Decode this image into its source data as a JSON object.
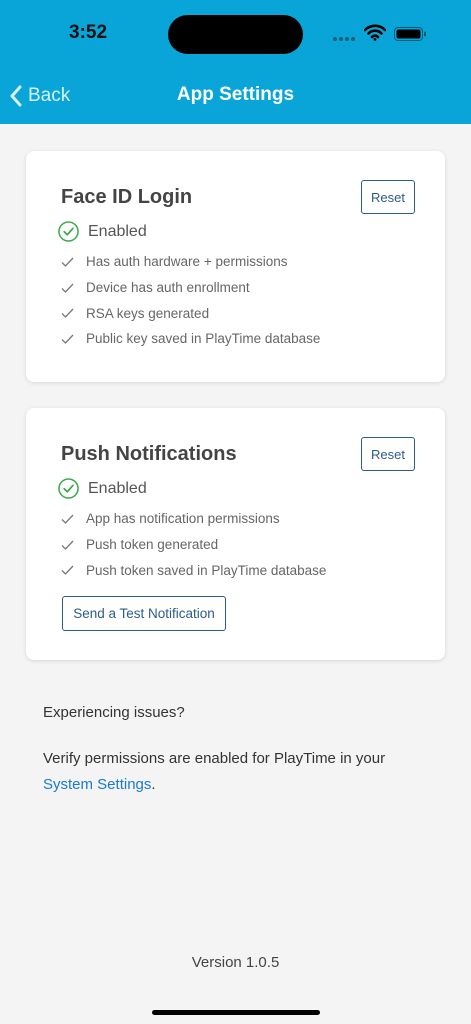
{
  "status_bar": {
    "time": "3:52"
  },
  "nav": {
    "back_label": "Back",
    "title": "App Settings"
  },
  "colors": {
    "header": "#0aa5d8",
    "accent": "#2d5c8a",
    "success": "#3aaa48",
    "link": "#1a7bd3"
  },
  "face_id": {
    "title": "Face ID Login",
    "reset_label": "Reset",
    "status": "Enabled",
    "checks": [
      "Has auth hardware + permissions",
      "Device has auth enrollment",
      "RSA keys generated",
      "Public key saved in PlayTime database"
    ]
  },
  "push": {
    "title": "Push Notifications",
    "reset_label": "Reset",
    "status": "Enabled",
    "checks": [
      "App has notification permissions",
      "Push token generated",
      "Push token saved in PlayTime database"
    ],
    "test_label": "Send a Test Notification"
  },
  "footer": {
    "issues": "Experiencing issues?",
    "verify_prefix": "Verify permissions are enabled for PlayTime in your",
    "settings_link": "System Settings",
    "verify_suffix": ".",
    "version": "Version 1.0.5"
  },
  "icons": [
    "back-chevron-icon",
    "wifi-icon",
    "battery-icon",
    "check-circle-icon",
    "checkmark-icon"
  ]
}
